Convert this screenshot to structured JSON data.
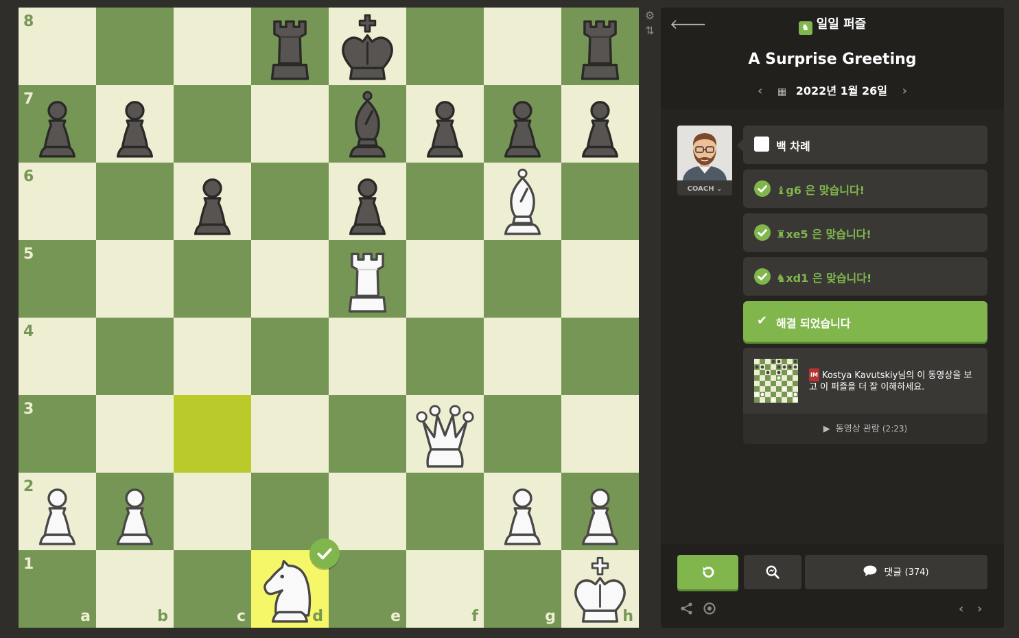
{
  "colors": {
    "light": "#eeeed2",
    "dark": "#769656",
    "highlight_light": "#f6f669",
    "highlight_dark": "#baca2b",
    "accent": "#81b64c"
  },
  "board": {
    "ranks": [
      "8",
      "7",
      "6",
      "5",
      "4",
      "3",
      "2",
      "1"
    ],
    "files": [
      "a",
      "b",
      "c",
      "d",
      "e",
      "f",
      "g",
      "h"
    ],
    "highlighted": [
      "c3",
      "d1"
    ],
    "last_move_check": "d1",
    "pieces": [
      {
        "sq": "d8",
        "color": "b",
        "type": "rook"
      },
      {
        "sq": "e8",
        "color": "b",
        "type": "king"
      },
      {
        "sq": "h8",
        "color": "b",
        "type": "rook"
      },
      {
        "sq": "a7",
        "color": "b",
        "type": "pawn"
      },
      {
        "sq": "b7",
        "color": "b",
        "type": "pawn"
      },
      {
        "sq": "e7",
        "color": "b",
        "type": "bishop"
      },
      {
        "sq": "f7",
        "color": "b",
        "type": "pawn"
      },
      {
        "sq": "g7",
        "color": "b",
        "type": "pawn"
      },
      {
        "sq": "h7",
        "color": "b",
        "type": "pawn"
      },
      {
        "sq": "c6",
        "color": "b",
        "type": "pawn"
      },
      {
        "sq": "e6",
        "color": "b",
        "type": "pawn"
      },
      {
        "sq": "g6",
        "color": "w",
        "type": "bishop"
      },
      {
        "sq": "e5",
        "color": "w",
        "type": "rook"
      },
      {
        "sq": "f3",
        "color": "w",
        "type": "queen"
      },
      {
        "sq": "a2",
        "color": "w",
        "type": "pawn"
      },
      {
        "sq": "b2",
        "color": "w",
        "type": "pawn"
      },
      {
        "sq": "g2",
        "color": "w",
        "type": "pawn"
      },
      {
        "sq": "h2",
        "color": "w",
        "type": "pawn"
      },
      {
        "sq": "d1",
        "color": "w",
        "type": "knight"
      },
      {
        "sq": "h1",
        "color": "w",
        "type": "king"
      }
    ]
  },
  "side_icons": [
    "gear-icon",
    "flip-board-icon"
  ],
  "panel": {
    "header_label": "일일 퍼즐",
    "title": "A Surprise Greeting",
    "date": "2022년 1월 26일"
  },
  "coach": {
    "label": "COACH ⌄"
  },
  "messages": {
    "turn": "백 차례",
    "move1": "g6 은 맞습니다!",
    "move2": "xe5 은 맞습니다!",
    "move3": "xd1 은 맞습니다!",
    "solved": "해결 되었습니다"
  },
  "video": {
    "badge": "IM",
    "text": "Kostya Kavutskiy님의 이 동영상을 보고 이 퍼즐을 더 잘 이해하세요.",
    "watch_label": "동영상 관람",
    "duration": "(2:23)"
  },
  "bottom": {
    "comments_label": "댓글",
    "comments_count": "(374)"
  }
}
